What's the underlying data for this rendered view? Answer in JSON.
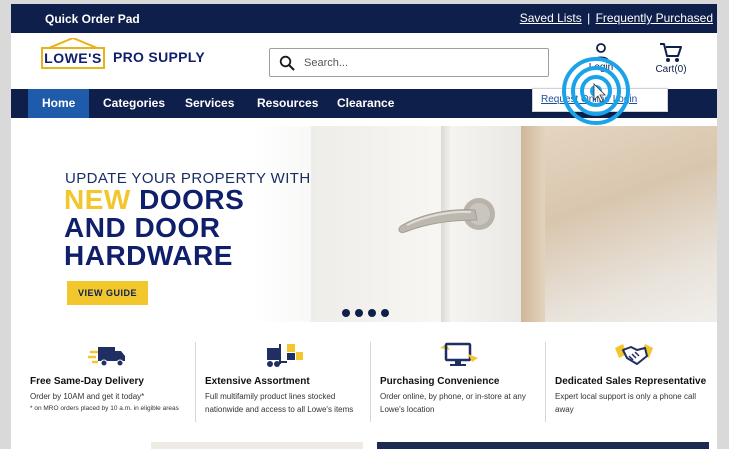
{
  "topbar": {
    "quick_order": "Quick Order Pad",
    "saved_lists": "Saved Lists",
    "separator": "|",
    "frequently_purchased": "Frequently Purchased"
  },
  "header": {
    "logo_brand": "LOWE'S",
    "logo_sub": "PRO SUPPLY",
    "search_placeholder": "Search...",
    "login_label": "Login",
    "cart_label": "Cart(0)",
    "dropdown_link": "Request Online Login"
  },
  "nav": {
    "items": [
      "Home",
      "Categories",
      "Services",
      "Resources",
      "Clearance"
    ],
    "active": "Home"
  },
  "hero": {
    "eyebrow": "UPDATE YOUR PROPERTY WITH",
    "line1_accent": "NEW",
    "line1_rest": " DOORS",
    "line2": "AND DOOR",
    "line3": "HARDWARE",
    "cta": "VIEW GUIDE",
    "slide_count": 4
  },
  "features": [
    {
      "icon": "delivery-truck-icon",
      "title": "Free Same-Day Delivery",
      "desc": "Order by 10AM and get it today*",
      "note": "* on MRO orders placed by 10 a.m. in eligible areas"
    },
    {
      "icon": "forklift-icon",
      "title": "Extensive Assortment",
      "desc": "Full multifamily product lines stocked nationwide and access to all Lowe's items"
    },
    {
      "icon": "computer-icon",
      "title": "Purchasing Convenience",
      "desc": "Order online, by phone, or in-store at any Lowe's location"
    },
    {
      "icon": "handshake-icon",
      "title": "Dedicated Sales Representative",
      "desc": "Expert local support is only a phone call away"
    }
  ],
  "colors": {
    "navy": "#0f1f4b",
    "active_blue": "#1f5bab",
    "accent_yellow": "#f2c72e",
    "click_highlight": "#1aa3e8"
  }
}
